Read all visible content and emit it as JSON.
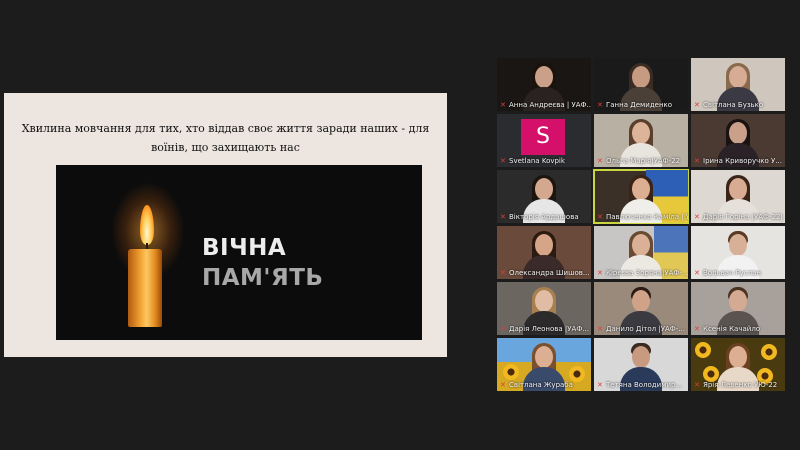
{
  "share": {
    "title": "Хвилина мовчання для тих, хто віддав своє життя заради наших - для воїнів, що захищають нас",
    "memorial_line1": "ВІЧНА",
    "memorial_line2": "ПАМ'ЯТЬ"
  },
  "colors": {
    "active_speaker": "#c9d640",
    "mic_muted": "#e03b3b",
    "avatar_bg": "#d4106a"
  },
  "participants": [
    {
      "name": "Анна Андреєва | УАФ...",
      "muted": true
    },
    {
      "name": "Ганна Демиденко",
      "muted": true
    },
    {
      "name": "Світлана Бузько",
      "muted": true
    },
    {
      "name": "Svetlana Kovpik",
      "muted": true,
      "avatar_letter": "S"
    },
    {
      "name": "Ольга Марія|УАФ-22",
      "muted": true
    },
    {
      "name": "Ірина Криворучко У...",
      "muted": true
    },
    {
      "name": "Вікторія Ардашова",
      "muted": true
    },
    {
      "name": "Павлюченко Каміла | У...",
      "muted": true,
      "active": true
    },
    {
      "name": "Дарія Горіна |УАФ-22|",
      "muted": true
    },
    {
      "name": "Олександра Шишов...",
      "muted": true
    },
    {
      "name": "Кірєєва Зоряна|УАФ-...",
      "muted": true
    },
    {
      "name": "Вольвач Руслан",
      "muted": true
    },
    {
      "name": "Дарія Леонова |УАФ...",
      "muted": true
    },
    {
      "name": "Данило Дітол |УАФ-...",
      "muted": true
    },
    {
      "name": "Ксенія Качайло",
      "muted": true
    },
    {
      "name": "Світлана Жураба",
      "muted": true
    },
    {
      "name": "Тетяна Володимир...",
      "muted": true
    },
    {
      "name": "Ярія Левенко УЮ-22",
      "muted": true
    }
  ]
}
